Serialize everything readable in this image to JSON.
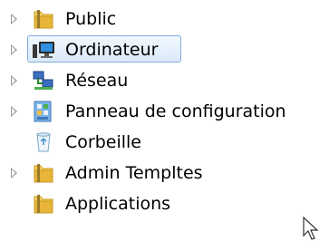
{
  "nav_tree": {
    "items": [
      {
        "label": "Public",
        "icon": "folder-icon",
        "expandable": true,
        "selected": false
      },
      {
        "label": "Ordinateur",
        "icon": "computer-icon",
        "expandable": true,
        "selected": true
      },
      {
        "label": "Réseau",
        "icon": "network-icon",
        "expandable": true,
        "selected": false
      },
      {
        "label": "Panneau de configuration",
        "icon": "control-panel-icon",
        "expandable": true,
        "selected": false
      },
      {
        "label": "Corbeille",
        "icon": "recycle-bin-icon",
        "expandable": false,
        "selected": false
      },
      {
        "label": "Admin Templtes",
        "icon": "folder-icon",
        "expandable": true,
        "selected": false
      },
      {
        "label": "Applications",
        "icon": "folder-icon",
        "expandable": false,
        "selected": false
      }
    ]
  },
  "colors": {
    "selection_border": "#84acdd",
    "selection_fill": "#dbeaf9",
    "expander": "#9a9a9a",
    "folder": "#e8b53a"
  }
}
